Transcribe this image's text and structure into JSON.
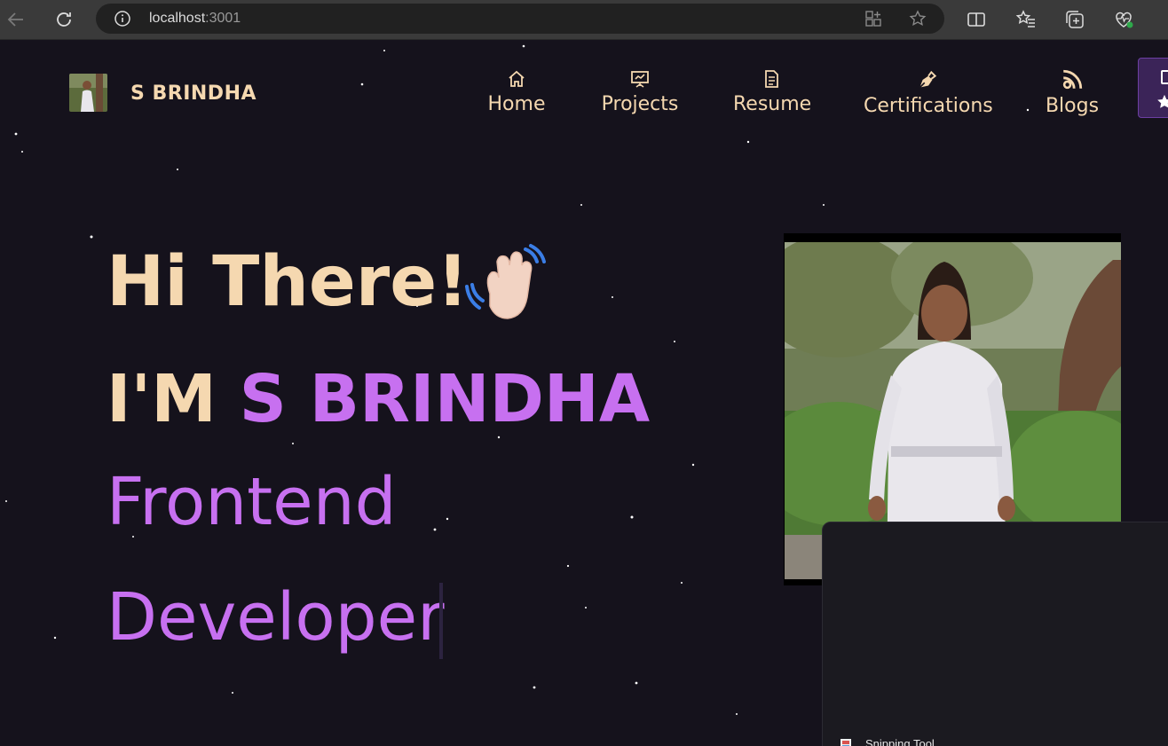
{
  "browser": {
    "url_host": "localhost",
    "url_port": ":3001"
  },
  "brand": {
    "name": "S BRINDHA"
  },
  "nav": {
    "items": [
      {
        "label": "Home",
        "icon": "home-icon"
      },
      {
        "label": "Projects",
        "icon": "presentation-icon"
      },
      {
        "label": "Resume",
        "icon": "document-icon"
      },
      {
        "label": "Certifications",
        "icon": "pen-nib-icon"
      },
      {
        "label": "Blogs",
        "icon": "rss-icon"
      }
    ]
  },
  "hero": {
    "greeting": "Hi There!",
    "intro_prefix": "I'M ",
    "intro_name": "S BRINDHA",
    "role_line1": "Frontend",
    "role_line2": "Developer"
  },
  "taskbar_preview": {
    "label": "Snipping Tool"
  },
  "colors": {
    "accent": "#c770f0",
    "text_warm": "#f5d8b0",
    "background": "#15121c"
  }
}
